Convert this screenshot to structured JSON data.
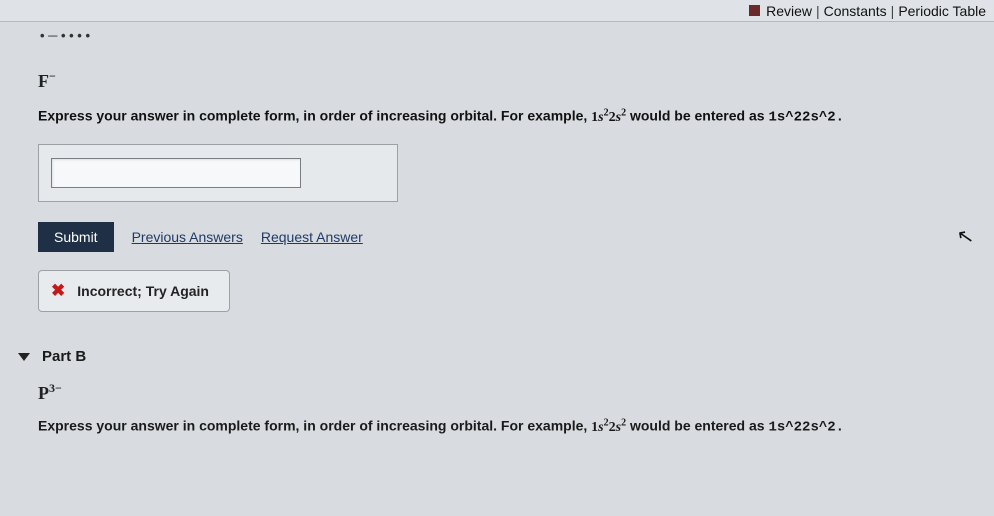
{
  "topbar": {
    "review": "Review",
    "constants": "Constants",
    "periodic": "Periodic Table"
  },
  "partA": {
    "section_dots": "• ─ • • • •",
    "species_base": "F",
    "species_sup": "−",
    "prompt_pre": "Express your answer in complete form, in order of increasing orbital. For example, ",
    "example_html": "1s²2s²",
    "prompt_post": " would be entered as ",
    "example_code": "1s^22s^2.",
    "input_value": "",
    "submit": "Submit",
    "prev_answers": "Previous Answers",
    "request_answer": "Request Answer",
    "feedback": "Incorrect; Try Again"
  },
  "partB": {
    "header": "Part B",
    "species_base": "P",
    "species_sup": "3−",
    "prompt_pre": "Express your answer in complete form, in order of increasing orbital. For example, ",
    "example_html": "1s²2s²",
    "prompt_post": " would be entered as ",
    "example_code": "1s^22s^2."
  }
}
